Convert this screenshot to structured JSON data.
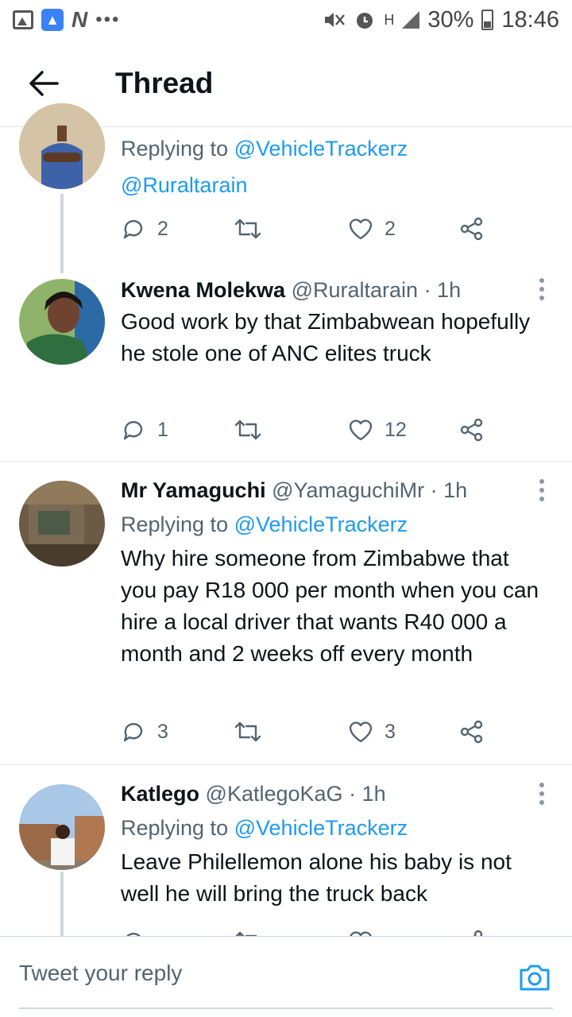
{
  "status_bar": {
    "battery": "30%",
    "time": "18:46",
    "network": "H",
    "icons": [
      "gallery-icon",
      "rocket-app-icon",
      "n-app-icon",
      "more-dots",
      "mute-vibrate-icon",
      "alarm-icon",
      "signal-icon",
      "battery-icon"
    ]
  },
  "header": {
    "title": "Thread",
    "back_icon": "arrow-left-icon"
  },
  "tweets": [
    {
      "name": "",
      "handle": "",
      "replying_label": "Replying to",
      "replying_to": "@VehicleTrackerz",
      "mention_line": "@Ruraltarain",
      "replies": "2",
      "likes": "2"
    },
    {
      "name": "Kwena Molekwa",
      "handle": "@Ruraltarain",
      "time": "· 1h",
      "text": "Good work by that Zimbabwean hopefully he stole one of ANC elites truck",
      "replies": "1",
      "likes": "12"
    },
    {
      "name": "Mr Yamaguchi",
      "handle": "@YamaguchiMr",
      "time": "· 1h",
      "replying_label": "Replying to",
      "replying_to": "@VehicleTrackerz",
      "text": "Why hire someone from Zimbabwe that you pay R18 000 per month when you can hire a local driver that wants R40 000 a month and 2 weeks off every month",
      "replies": "3",
      "likes": "3"
    },
    {
      "name": "Katlego",
      "handle": "@KatlegoKaG",
      "time": "· 1h",
      "replying_label": "Replying to",
      "replying_to": "@VehicleTrackerz",
      "text": "Leave Philellemon alone his baby is not well he will bring the truck back"
    }
  ],
  "reply_bar": {
    "placeholder": "Tweet your reply"
  },
  "colors": {
    "accent": "#1d9bf0",
    "text_secondary": "#536471",
    "divider": "#e1e6ea"
  }
}
